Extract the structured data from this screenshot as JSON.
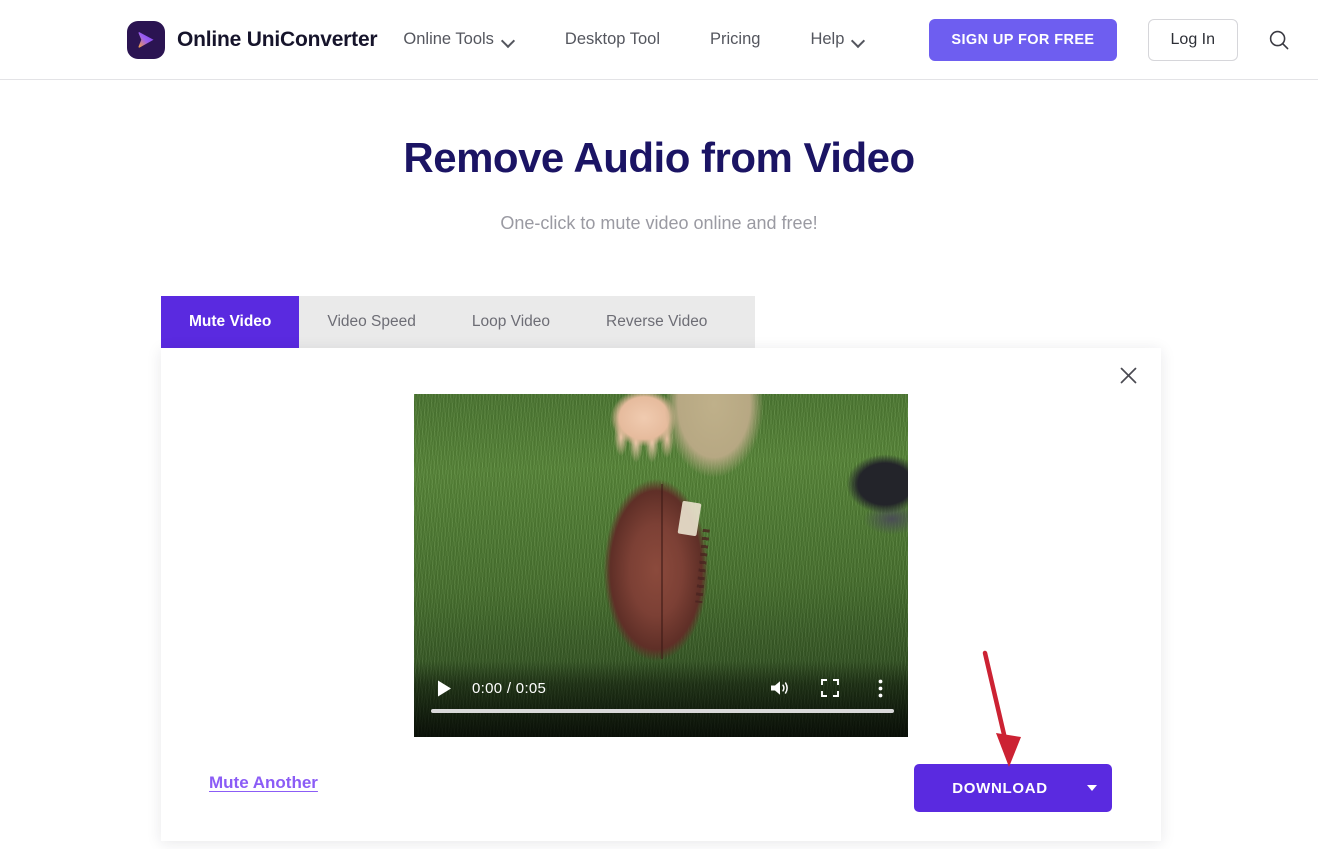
{
  "header": {
    "brand": {
      "name": "Online UniConverter",
      "logo_icon": "play-logo-icon"
    },
    "nav": [
      {
        "label": "Online Tools",
        "has_dropdown": true
      },
      {
        "label": "Desktop Tool",
        "has_dropdown": false
      },
      {
        "label": "Pricing",
        "has_dropdown": false
      },
      {
        "label": "Help",
        "has_dropdown": true
      }
    ],
    "signup_label": "SIGN UP FOR FREE",
    "login_label": "Log In",
    "search_icon": "search-icon"
  },
  "hero": {
    "title": "Remove Audio from Video",
    "subtitle": "One-click to mute video online and free!"
  },
  "tabs": [
    {
      "label": "Mute Video",
      "active": true
    },
    {
      "label": "Video Speed",
      "active": false
    },
    {
      "label": "Loop Video",
      "active": false
    },
    {
      "label": "Reverse Video",
      "active": false
    }
  ],
  "card": {
    "close_icon": "close-icon",
    "player": {
      "play_icon": "play-icon",
      "time": "0:00 / 0:05",
      "current_time": "0:00",
      "duration": "0:05",
      "volume_icon": "volume-icon",
      "fullscreen_icon": "fullscreen-icon",
      "more_icon": "kebab-menu-icon",
      "progress_percent": 0
    },
    "mute_another_label": "Mute Another",
    "download_label": "DOWNLOAD",
    "download_caret_icon": "chevron-down-icon"
  },
  "annotation": {
    "arrow_color": "#cc2233",
    "points_to": "DOWNLOAD"
  },
  "colors": {
    "brand_purple": "#5a2ae0",
    "signup_purple": "#6e5ef0",
    "link_purple": "#8b5cf6",
    "title_navy": "#1b1464",
    "tabbar_gray": "#eaeaea",
    "subtitle_gray": "#9a9aa2",
    "annotation_red": "#cc2233"
  }
}
